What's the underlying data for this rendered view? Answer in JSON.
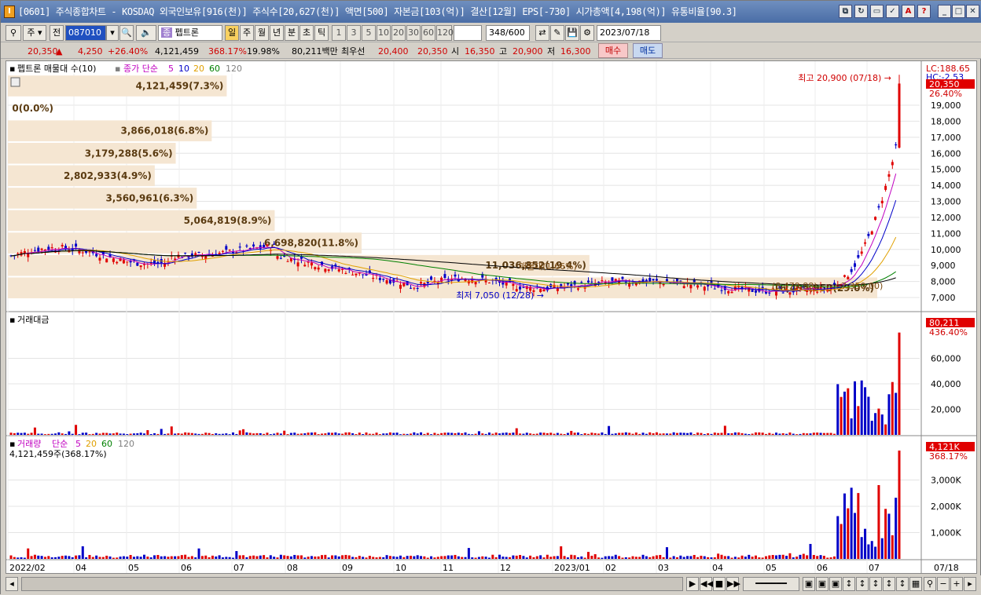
{
  "window": {
    "title": "[0601] 주식종합차트 - KOSDAQ 외국인보유[916(천)] 주식수[20,627(천)] 액면[500] 자본금[103(억)] 결산[12월] EPS[-730] 시가총액[4,198(억)] 유통비율[90.3]",
    "icon": "I",
    "buttons": [
      "restore-icon",
      "refresh-icon",
      "window-icon",
      "checkmark-icon",
      "font-icon",
      "help-icon",
      "minimize-icon",
      "maximize-icon",
      "close-icon"
    ],
    "button_glyphs": [
      "⧉",
      "↻",
      "▭",
      "✓",
      "A",
      "?",
      "_",
      "□",
      "✕"
    ]
  },
  "toolbar": {
    "period_select": "주",
    "prev_label": "전",
    "code_value": "087010",
    "stock_name": "펩트론",
    "day_label": "일",
    "week_label": "주",
    "month_label": "월",
    "year_label": "년",
    "minute_label": "분",
    "second_label": "초",
    "tick_label": "틱",
    "intervals": [
      "1",
      "3",
      "5",
      "10",
      "20",
      "30",
      "60",
      "120"
    ],
    "count_value": "348",
    "count_total": "/600",
    "date_value": "2023/07/18"
  },
  "pricebar": {
    "price": "20,350",
    "arrow": "▲",
    "change": "4,250",
    "change_pct": "+26.40%",
    "volume": "4,121,459",
    "volume_pct": "368.17%",
    "turnover": "19.98%",
    "amount": "80,211백만",
    "best_ask_label": "최우선",
    "best_ask": "20,400",
    "best_bid": "20,350",
    "open_label": "시",
    "open": "16,350",
    "high_label": "고",
    "high": "20,900",
    "low_label": "저",
    "low": "16,300",
    "buy_label": "매수",
    "sell_label": "매도"
  },
  "panel_price": {
    "legend_title": "펩트론 매물대 수(10)",
    "legend_ma": "종가 단순",
    "ma_periods": [
      "5",
      "10",
      "20",
      "60",
      "120"
    ],
    "ma_colors": [
      "#c000c0",
      "#0000c8",
      "#e0a000",
      "#008000",
      "#000000"
    ],
    "lc_label": "LC:188.65",
    "hc_label": "HC:-2.53",
    "last_price_label": "20,350",
    "last_pct_label": "26.40%",
    "high_marker": "최고 20,900 (07/18) →",
    "low_marker": "최저 7,050 (12/28) →",
    "volume_profile": [
      "4,121,459(7.3%)",
      "0(0.0%)",
      "3,866,018(6.8%)",
      "3,179,288(5.6%)",
      "2,802,933(4.9%)",
      "3,560,961(6.3%)",
      "5,064,819(8.9%)",
      "6,698,820(11.8%)",
      "11,036,852(19.4%)",
      "16,495,950(29.0%)"
    ],
    "overlap_labels": [
      "매물대(1.66%)",
      "(8,479,88)",
      "7,350,00)"
    ],
    "y_ticks": [
      "19,000",
      "18,000",
      "17,000",
      "16,000",
      "15,000",
      "14,000",
      "13,000",
      "12,000",
      "11,000",
      "10,000",
      "9,000",
      "8,000",
      "7,000"
    ]
  },
  "panel_amount": {
    "legend": "거래대금",
    "last_label": "80,211",
    "last_pct": "436.40%",
    "y_ticks": [
      "60,000",
      "40,000",
      "20,000"
    ]
  },
  "panel_volume": {
    "legend": "거래량",
    "legend_ma": "단순",
    "ma_periods": [
      "5",
      "20",
      "60",
      "120"
    ],
    "ma_colors": [
      "#c000c0",
      "#e0a000",
      "#008000",
      "#000000"
    ],
    "sub_label": "4,121,459주(368.17%)",
    "last_label": "4,121K",
    "last_pct": "368.17%",
    "y_ticks": [
      "3,000K",
      "2,000K",
      "1,000K"
    ]
  },
  "x_axis": {
    "labels": [
      "2022/02",
      "04",
      "05",
      "06",
      "07",
      "08",
      "09",
      "10",
      "11",
      "12",
      "2023/01",
      "02",
      "03",
      "04",
      "05",
      "06",
      "07"
    ],
    "right_label": "07/18"
  },
  "chart_data": {
    "type": "candlestick",
    "period": "weekly",
    "last": 20350,
    "high": {
      "value": 20900,
      "date": "07/18"
    },
    "low": {
      "value": 7050,
      "date": "12/28"
    },
    "ylim": [
      6500,
      21000
    ],
    "volume_profile_pct": [
      7.3,
      0.0,
      6.8,
      5.6,
      4.9,
      6.3,
      8.9,
      11.8,
      19.4,
      29.0
    ]
  }
}
